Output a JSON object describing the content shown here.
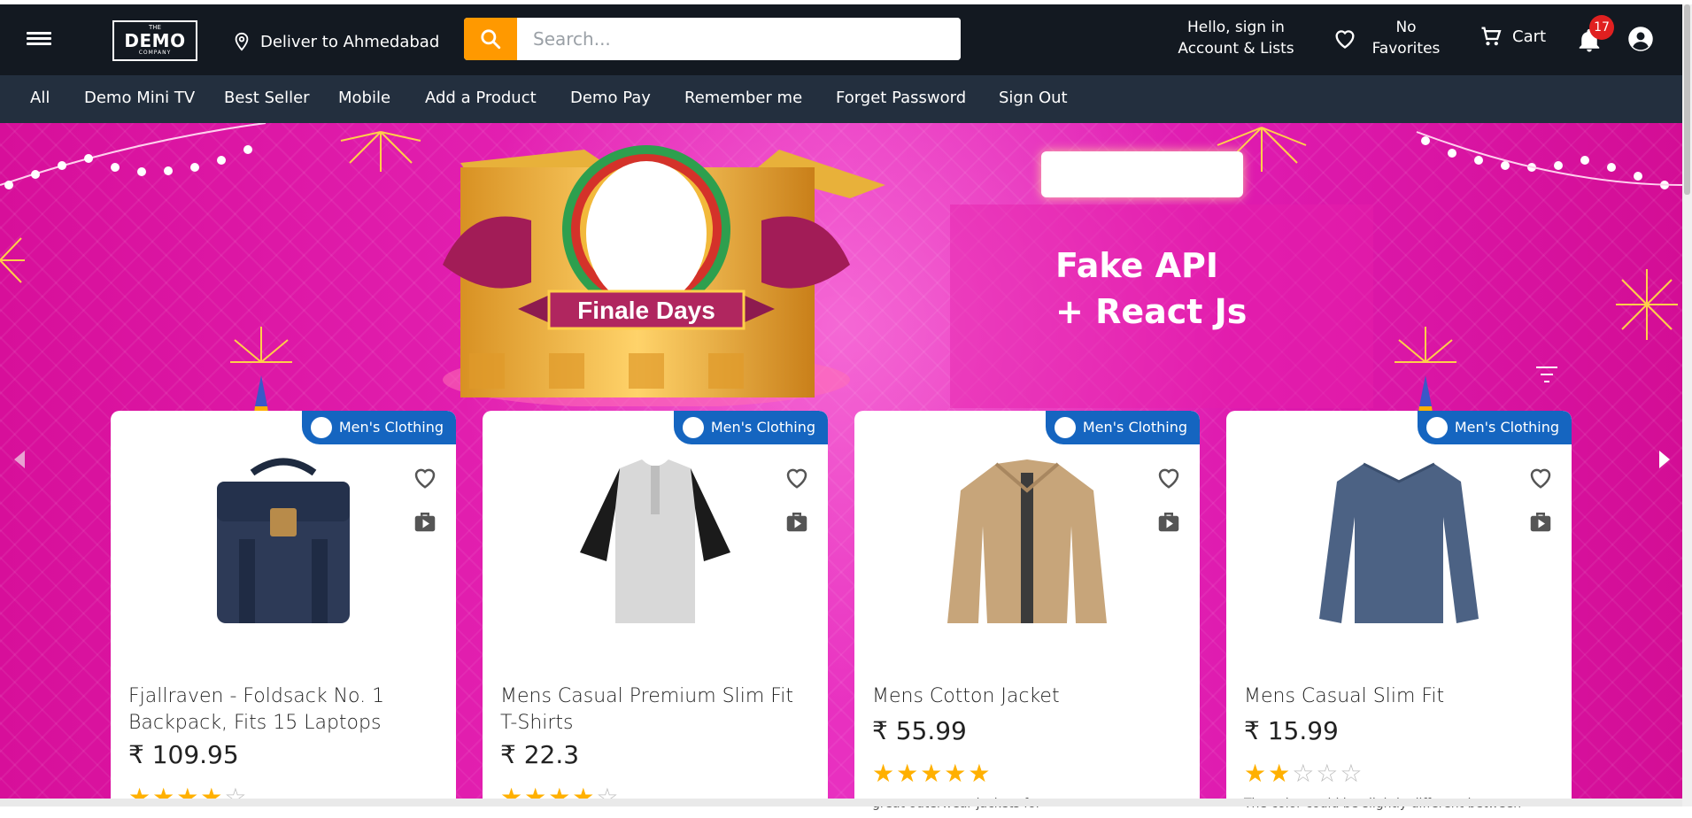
{
  "header": {
    "logo": {
      "the": "THE",
      "demo": "DEMO",
      "company": "COMPANY"
    },
    "location": "Deliver to Ahmedabad",
    "search_placeholder": "Search...",
    "account_line1": "Hello, sign in",
    "account_line2": "Account & Lists",
    "favorites_line1": "No",
    "favorites_line2": "Favorites",
    "cart": "Cart",
    "notification_count": "17"
  },
  "nav": {
    "items": [
      "All",
      "Demo Mini TV",
      "Best Seller",
      "Mobile",
      "Add a Product",
      "Demo Pay",
      "Remember me",
      "Forget Password",
      "Sign Out"
    ]
  },
  "banner": {
    "badge": "Finale Days",
    "heading_line1": "Fake API",
    "heading_line2": "+ React Js"
  },
  "products": [
    {
      "category": "Men's Clothing",
      "title": "Fjallraven - Foldsack No. 1 Backpack, Fits 15 Laptops",
      "price": "₹ 109.95",
      "rating": 4,
      "description": ""
    },
    {
      "category": "Men's Clothing",
      "title": "Mens Casual Premium Slim Fit T-Shirts",
      "price": "₹ 22.3",
      "rating": 4,
      "description": ""
    },
    {
      "category": "Men's Clothing",
      "title": "Mens Cotton Jacket",
      "price": "₹ 55.99",
      "rating": 5,
      "description": "great outerwear jackets for"
    },
    {
      "category": "Men's Clothing",
      "title": "Mens Casual Slim Fit",
      "price": "₹ 15.99",
      "rating": 2,
      "description": "The color could be slightly different between"
    }
  ],
  "colors": {
    "topbar": "#131921",
    "navbar": "#232f3e",
    "accent": "#ff9900",
    "badge": "#1565c0",
    "star": "#ffb000"
  }
}
